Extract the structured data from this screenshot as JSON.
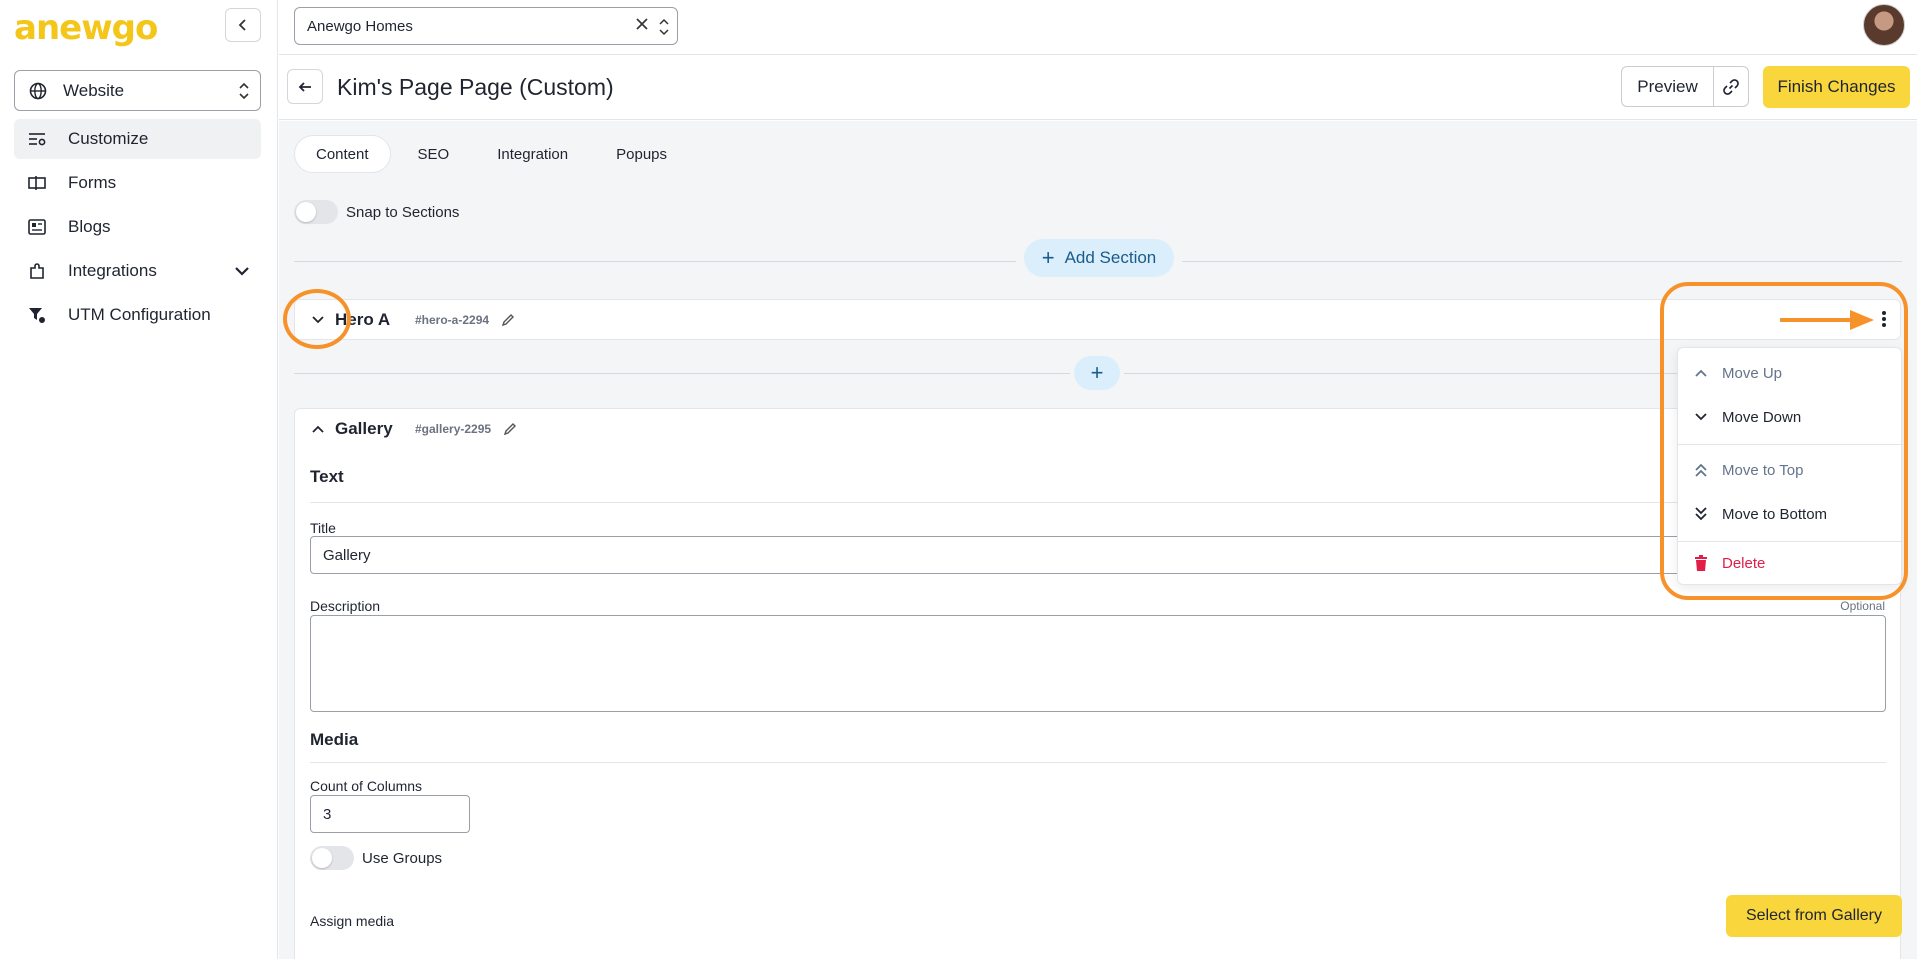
{
  "brand": {
    "logo_text": "anewgo",
    "accent": "#f9d63c",
    "highlight": "#f7922a"
  },
  "sidebar": {
    "site_select": "Website",
    "items": [
      {
        "label": "Customize",
        "icon": "sliders-icon",
        "active": true
      },
      {
        "label": "Forms",
        "icon": "form-icon"
      },
      {
        "label": "Blogs",
        "icon": "newspaper-icon"
      },
      {
        "label": "Integrations",
        "icon": "puzzle-icon"
      },
      {
        "label": "UTM Configuration",
        "icon": "filter-gear-icon"
      }
    ]
  },
  "topbar": {
    "community": "Anewgo Homes"
  },
  "page": {
    "title": "Kim's Page Page (Custom)",
    "preview_label": "Preview",
    "finish_label": "Finish Changes"
  },
  "tabs": [
    {
      "label": "Content",
      "active": true
    },
    {
      "label": "SEO"
    },
    {
      "label": "Integration"
    },
    {
      "label": "Popups"
    }
  ],
  "snap_label": "Snap to Sections",
  "add_section_label": "Add Section",
  "sections": {
    "hero": {
      "name": "Hero A",
      "anchor": "#hero-a-2294"
    },
    "gallery": {
      "name": "Gallery",
      "anchor": "#gallery-2295",
      "text_heading": "Text",
      "title_label": "Title",
      "title_value": "Gallery",
      "description_label": "Description",
      "optional_label": "Optional",
      "media_heading": "Media",
      "columns_label": "Count of Columns",
      "columns_value": "3",
      "use_groups_label": "Use Groups",
      "assign_media_label": "Assign media",
      "select_gallery_label": "Select from Gallery"
    }
  },
  "menu": {
    "move_up": "Move Up",
    "move_down": "Move Down",
    "move_top": "Move to Top",
    "move_bottom": "Move to Bottom",
    "delete": "Delete"
  }
}
